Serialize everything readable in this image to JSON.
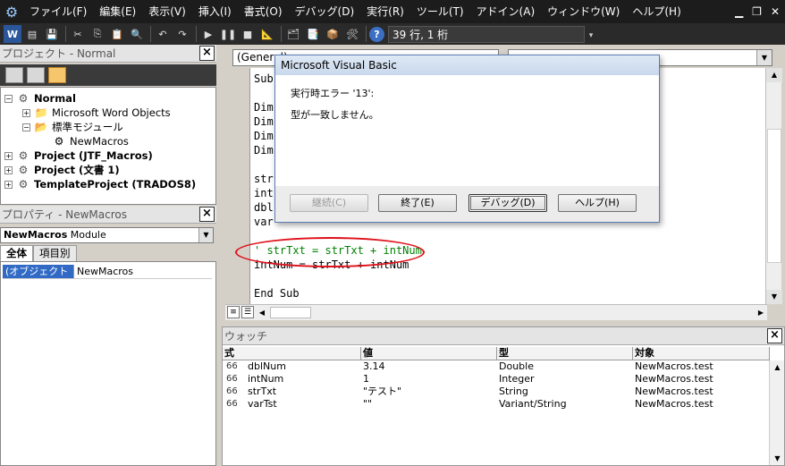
{
  "menubar": {
    "app_icon": "vbe-icon",
    "items": [
      {
        "label": "ファイル(F)"
      },
      {
        "label": "編集(E)"
      },
      {
        "label": "表示(V)"
      },
      {
        "label": "挿入(I)"
      },
      {
        "label": "書式(O)"
      },
      {
        "label": "デバッグ(D)"
      },
      {
        "label": "実行(R)"
      },
      {
        "label": "ツール(T)"
      },
      {
        "label": "アドイン(A)"
      },
      {
        "label": "ウィンドウ(W)"
      },
      {
        "label": "ヘルプ(H)"
      }
    ],
    "window_controls": [
      "minimize-icon",
      "restore-icon",
      "close-icon"
    ]
  },
  "toolbar": {
    "position_text": "39 行, 1 桁",
    "icons": [
      "word-icon",
      "insert-module-icon",
      "save-icon",
      "cut-icon",
      "copy-icon",
      "paste-icon",
      "find-icon",
      "undo-icon",
      "redo-icon",
      "run-icon",
      "break-icon",
      "reset-icon",
      "design-mode-icon",
      "project-explorer-icon",
      "properties-icon",
      "object-browser-icon",
      "toolbox-icon",
      "help-icon"
    ]
  },
  "project_panel": {
    "title": "プロジェクト - Normal",
    "close": "×",
    "tree": [
      {
        "label": "Normal",
        "bold": true,
        "expander": "−",
        "icon": "project-icon"
      },
      {
        "label": "Microsoft Word Objects",
        "bold": false,
        "expander": "+",
        "icon": "folder-icon"
      },
      {
        "label": "標準モジュール",
        "bold": false,
        "expander": "−",
        "icon": "folder-icon"
      },
      {
        "label": "NewMacros",
        "bold": false,
        "expander": "",
        "icon": "module-icon"
      },
      {
        "label": "Project (JTF_Macros)",
        "bold": true,
        "expander": "+",
        "icon": "project-icon"
      },
      {
        "label": "Project (文書 1)",
        "bold": true,
        "expander": "+",
        "icon": "project-icon"
      },
      {
        "label": "TemplateProject (TRADOS8)",
        "bold": true,
        "expander": "+",
        "icon": "project-icon"
      }
    ]
  },
  "properties_panel": {
    "title": "プロパティ - NewMacros",
    "close": "×",
    "object_name": "NewMacros",
    "object_type": "Module",
    "tabs": [
      {
        "label": "全体",
        "active": true
      },
      {
        "label": "項目別",
        "active": false
      }
    ],
    "rows": [
      {
        "name": "(オブジェクト名)",
        "value": "NewMacros"
      }
    ]
  },
  "code_window": {
    "object_select": "(General)",
    "lines": [
      {
        "text": "Sub",
        "comment": false
      },
      {
        "text": "",
        "comment": false
      },
      {
        "text": "Dim",
        "comment": false
      },
      {
        "text": "Dim",
        "comment": false
      },
      {
        "text": "Dim",
        "comment": false
      },
      {
        "text": "Dim",
        "comment": false
      },
      {
        "text": "",
        "comment": false
      },
      {
        "text": "str",
        "comment": false
      },
      {
        "text": "int",
        "comment": false
      },
      {
        "text": "dbl",
        "comment": false
      },
      {
        "text": "var",
        "comment": false
      },
      {
        "text": "",
        "comment": false
      },
      {
        "text": "' strTxt = strTxt + intNum",
        "comment": true
      },
      {
        "text": "intNum = strTxt + intNum",
        "comment": false
      },
      {
        "text": "",
        "comment": false
      },
      {
        "text": "End Sub",
        "comment": false
      }
    ]
  },
  "watch_window": {
    "title": "ウォッチ",
    "close": "×",
    "headers": {
      "expr": "式",
      "value": "値",
      "type": "型",
      "context": "対象"
    },
    "rows": [
      {
        "expr": "dblNum",
        "value": "3.14",
        "type": "Double",
        "context": "NewMacros.test"
      },
      {
        "expr": "intNum",
        "value": "1",
        "type": "Integer",
        "context": "NewMacros.test"
      },
      {
        "expr": "strTxt",
        "value": "\"テスト\"",
        "type": "String",
        "context": "NewMacros.test"
      },
      {
        "expr": "varTst",
        "value": "\"\"",
        "type": "Variant/String",
        "context": "NewMacros.test"
      }
    ]
  },
  "dialog": {
    "title": "Microsoft Visual Basic",
    "message_line1": "実行時エラー '13':",
    "message_line2": "型が一致しません。",
    "buttons": {
      "continue": "継続(C)",
      "end": "終了(E)",
      "debug": "デバッグ(D)",
      "help": "ヘルプ(H)"
    }
  },
  "colors": {
    "highlight_ellipse": "#e0101a",
    "comment_text": "#008000",
    "selection": "#316ac5"
  }
}
